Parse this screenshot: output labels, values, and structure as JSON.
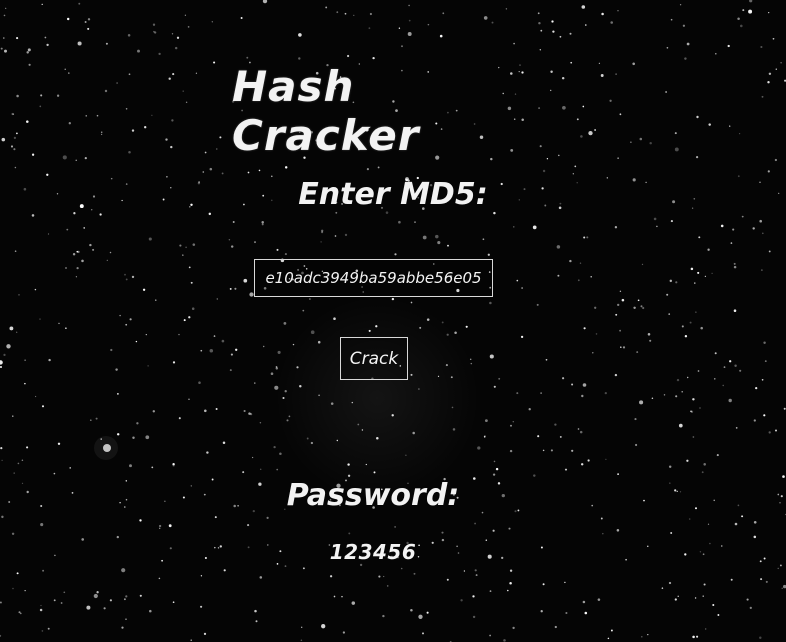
{
  "app": {
    "title": "Hash Cracker"
  },
  "form": {
    "prompt_label": "Enter MD5:",
    "hash_value": "e10adc3949ba59abbe56e05",
    "button_label": "Crack"
  },
  "result": {
    "label": "Password:",
    "value": "123456"
  },
  "background": {
    "theme": "starfield",
    "base_color": "#000000",
    "star_color": "#ffffff"
  }
}
